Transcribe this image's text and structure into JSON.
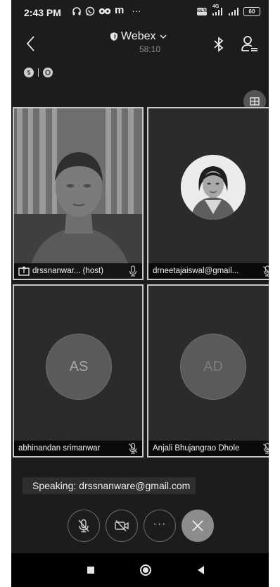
{
  "status_bar": {
    "time": "2:43 PM",
    "carrier_icon_text": "m",
    "dots": "···",
    "net_badge": "VoLTE",
    "network_type": "4G",
    "battery": "60"
  },
  "header": {
    "title": "Webex",
    "timer": "58:10"
  },
  "participants": [
    {
      "name": "drssnanwar... (host)",
      "mic": "on",
      "video": "on"
    },
    {
      "name": "drneetajaiswal@gmail...",
      "mic": "muted",
      "video": "off",
      "avatar": "photo"
    },
    {
      "name": "abhinandan srimanwar",
      "mic": "muted",
      "video": "off",
      "initials": "AS"
    },
    {
      "name": "Anjali Bhujangrao Dhole",
      "mic": "muted",
      "video": "off",
      "initials": "AD"
    }
  ],
  "speaking": "Speaking: drssnanware@gmail.com",
  "controls": {
    "more_label": "···"
  },
  "colors": {
    "background": "#1c1c1c",
    "tile": "#2b2b2b",
    "tile_border": "#c8c8c8",
    "end_call": "#8c8c8c"
  },
  "icons": {
    "back": "chevron-left-icon",
    "shield": "shield-icon",
    "dropdown": "chevron-down-icon",
    "bluetooth": "bluetooth-icon",
    "participants": "participants-list-icon",
    "layout": "grid-layout-icon",
    "share": "share-icon",
    "mic": "microphone-icon",
    "mic_muted": "microphone-muted-icon",
    "video_off": "video-off-icon",
    "more": "more-icon",
    "end": "close-icon"
  }
}
